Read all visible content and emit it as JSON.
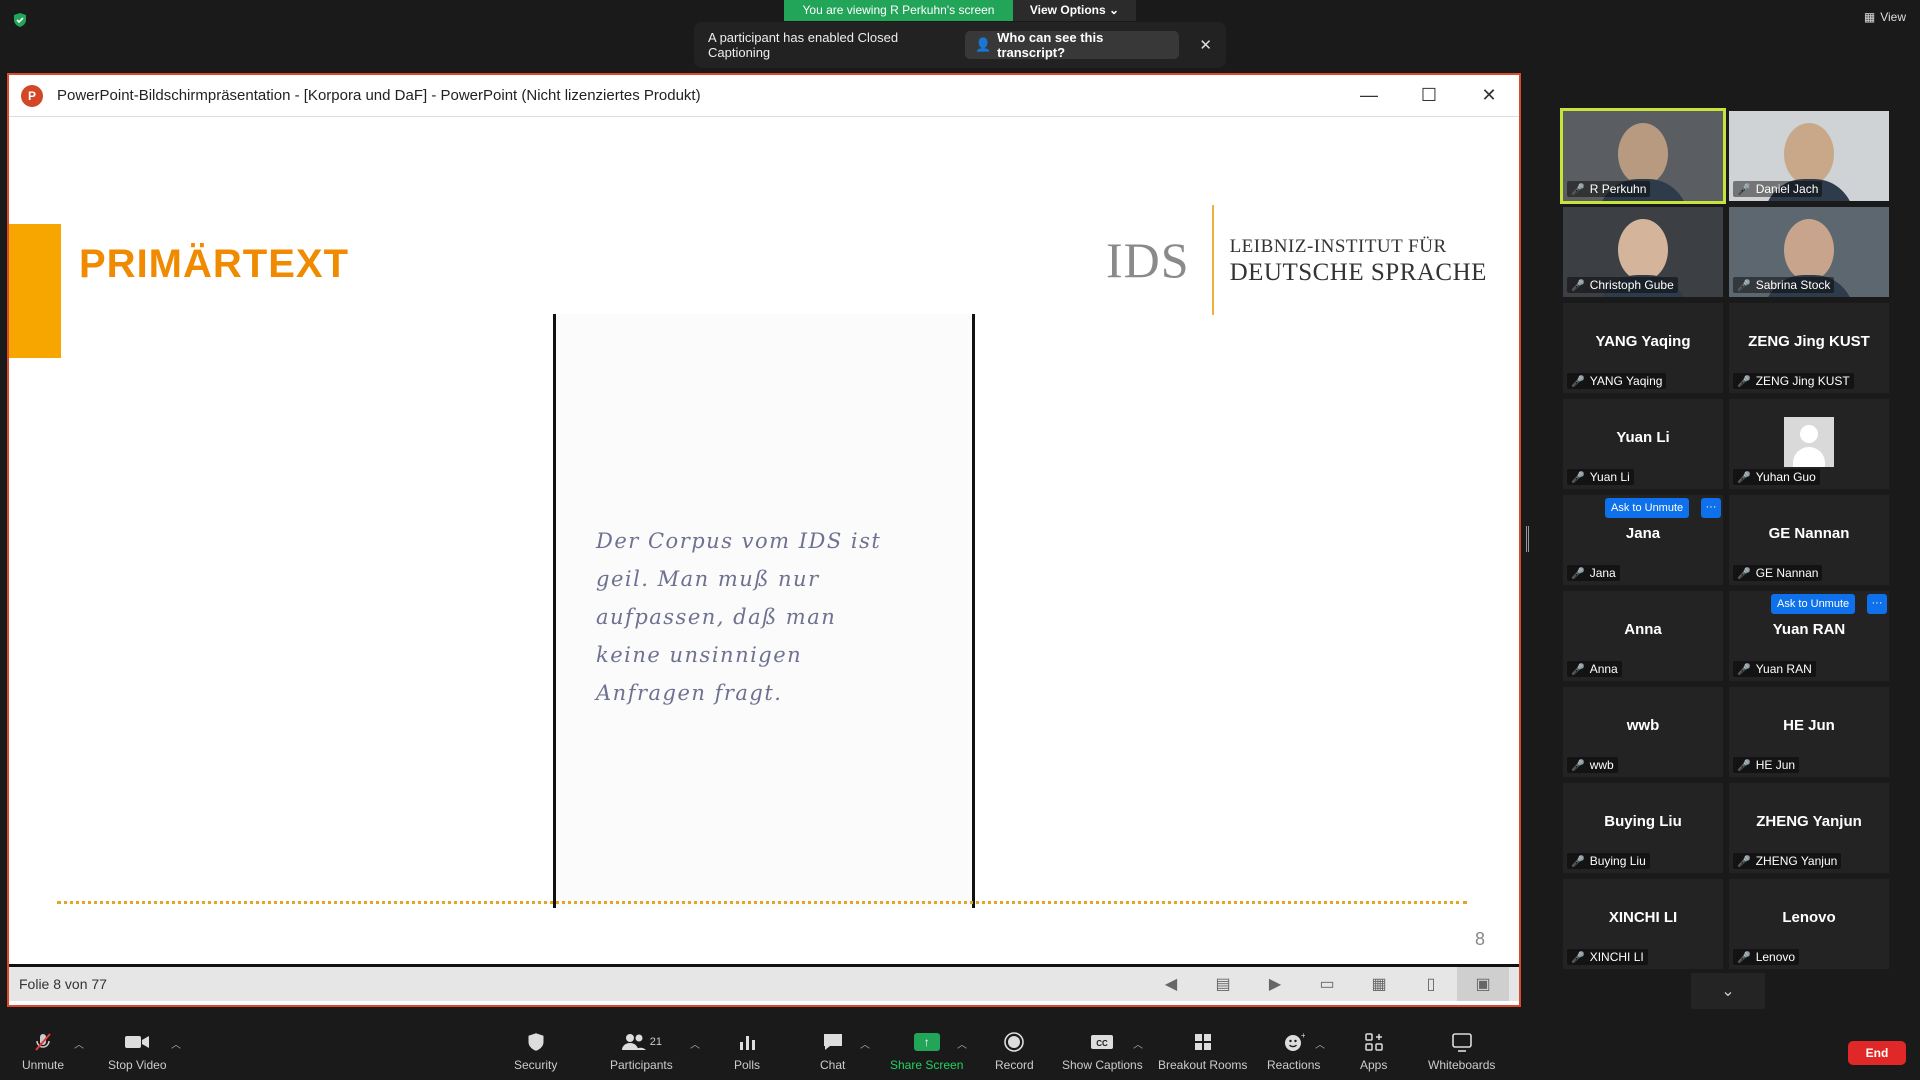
{
  "zoom_top": {
    "viewing_banner": "You are viewing R Perkuhn's screen",
    "view_options": "View Options",
    "view_label": "View",
    "cc_message": "A participant has enabled Closed Captioning",
    "cc_button": "Who can see this transcript?",
    "security_color": "#23a559"
  },
  "ppt": {
    "window_title": "PowerPoint-Bildschirmpräsentation - [Korpora und DaF] - PowerPoint (Nicht lizenziertes Produkt)",
    "slide_title": "PRIMÄRTEXT",
    "logo_abbrev": "IDS",
    "logo_line1": "LEIBNIZ-INSTITUT FÜR",
    "logo_line2": "DEUTSCHE SPRACHE",
    "handwriting": "Der Corpus vom IDS ist\ngeil. Man muß nur\naufpassen, daß man\nkeine unsinnigen\nAnfragen fragt.",
    "slide_number": "8",
    "status_text": "Folie 8 von 77",
    "accent_color": "#f7a600"
  },
  "participants": [
    {
      "name": "R Perkuhn",
      "video": true,
      "active": true
    },
    {
      "name": "Daniel Jach",
      "video": true
    },
    {
      "name": "Christoph Gube",
      "video": true
    },
    {
      "name": "Sabrina Stock",
      "video": true
    },
    {
      "name": "YANG Yaqing",
      "display": "YANG Yaqing"
    },
    {
      "name": "ZENG Jing KUST",
      "display": "ZENG Jing KUST"
    },
    {
      "name": "Yuan Li",
      "display": "Yuan Li"
    },
    {
      "name": "Yuhan Guo",
      "avatar": true
    },
    {
      "name": "Jana",
      "display": "Jana"
    },
    {
      "name": "GE Nannan",
      "display": "GE Nannan"
    },
    {
      "name": "Anna",
      "display": "Anna"
    },
    {
      "name": "Yuan RAN",
      "display": "Yuan RAN"
    },
    {
      "name": "wwb",
      "display": "wwb"
    },
    {
      "name": "HE Jun",
      "display": "HE Jun"
    },
    {
      "name": "Buying Liu",
      "display": "Buying Liu"
    },
    {
      "name": "ZHENG Yanjun",
      "display": "ZHENG Yanjun"
    },
    {
      "name": "XINCHI LI",
      "display": "XINCHI LI"
    },
    {
      "name": "Lenovo",
      "display": "Lenovo"
    }
  ],
  "ask_unmute": "Ask to Unmute",
  "ask_more": "···",
  "toolbar": {
    "unmute": "Unmute",
    "stop_video": "Stop Video",
    "security": "Security",
    "participants": "Participants",
    "participants_count": "21",
    "polls": "Polls",
    "chat": "Chat",
    "share_screen": "Share Screen",
    "record": "Record",
    "show_captions": "Show Captions",
    "breakout_rooms": "Breakout Rooms",
    "reactions": "Reactions",
    "apps": "Apps",
    "whiteboards": "Whiteboards",
    "end": "End"
  }
}
